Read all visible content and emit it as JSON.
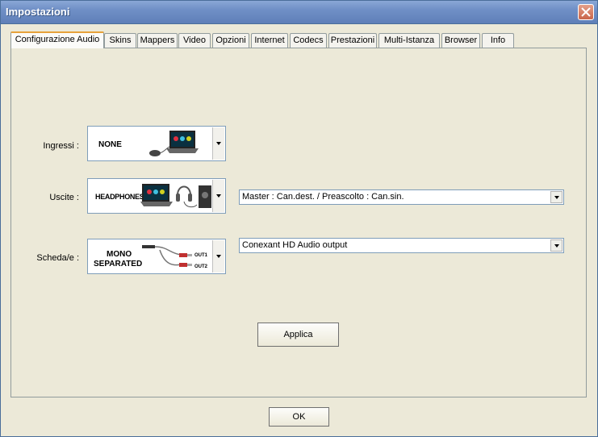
{
  "window": {
    "title": "Impostazioni"
  },
  "tabs": [
    {
      "label": "Configurazione Audio",
      "active": true
    },
    {
      "label": "Skins"
    },
    {
      "label": "Mappers"
    },
    {
      "label": "Video"
    },
    {
      "label": "Opzioni"
    },
    {
      "label": "Internet"
    },
    {
      "label": "Codecs"
    },
    {
      "label": "Prestazioni"
    },
    {
      "label": "Multi-Istanza"
    },
    {
      "label": "Browser"
    },
    {
      "label": "Info"
    }
  ],
  "audio": {
    "inputs": {
      "label": "Ingressi :",
      "image_text": "NONE"
    },
    "outputs": {
      "label": "Uscite :",
      "image_text": "HEADPHONES",
      "routing": "Master : Can.dest. / Preascolto : Can.sin."
    },
    "card": {
      "label": "Scheda/e :",
      "image_text_1": "MONO",
      "image_text_2": "SEPARATED",
      "out1": "OUT1",
      "out2": "OUT2",
      "device": "Conexant HD Audio output"
    },
    "apply_label": "Applica"
  },
  "ok_label": "OK"
}
